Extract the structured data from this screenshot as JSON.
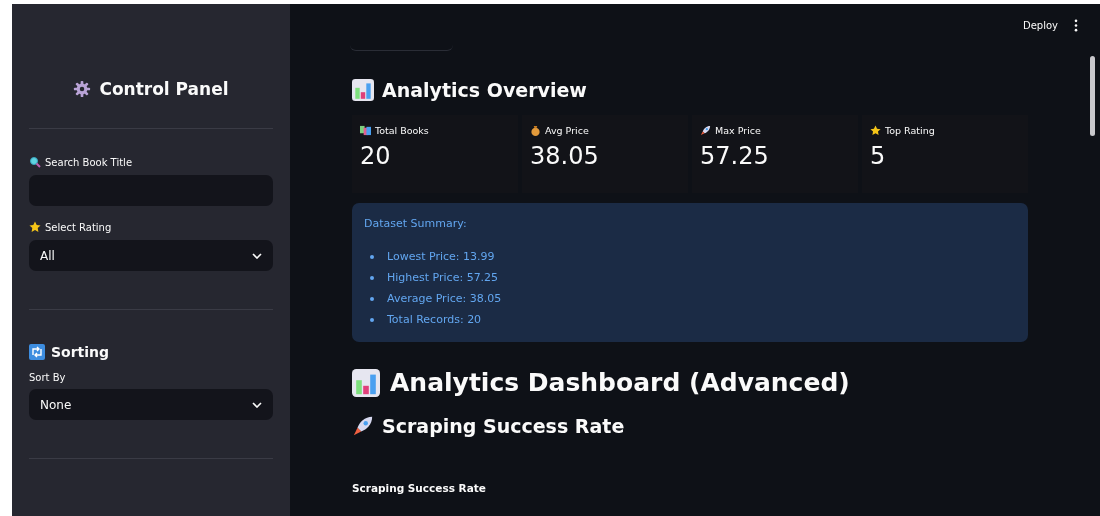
{
  "sidebar": {
    "title": "Control Panel",
    "filters": [
      {
        "kind": "text",
        "label": "Search Book Title"
      },
      {
        "kind": "select",
        "label": "Select Rating",
        "value": "All"
      }
    ],
    "sorting": {
      "heading": "Sorting",
      "label": "Sort By",
      "value": "None"
    }
  },
  "header": {
    "deploy": "Deploy"
  },
  "overview": {
    "title": "Analytics Overview",
    "metrics": [
      {
        "label": "Total Books",
        "value": "20"
      },
      {
        "label": "Avg Price",
        "value": "38.05"
      },
      {
        "label": "Max Price",
        "value": "57.25"
      },
      {
        "label": "Top Rating",
        "value": "5"
      }
    ],
    "summary": {
      "title": "Dataset Summary:",
      "items": [
        "Lowest Price: 13.99",
        "Highest Price: 57.25",
        "Average Price: 38.05",
        "Total Records: 20"
      ]
    }
  },
  "dashboard": {
    "title": "Analytics Dashboard (Advanced)",
    "subtitle": "Scraping Success Rate",
    "chart_title": "Scraping Success Rate"
  }
}
